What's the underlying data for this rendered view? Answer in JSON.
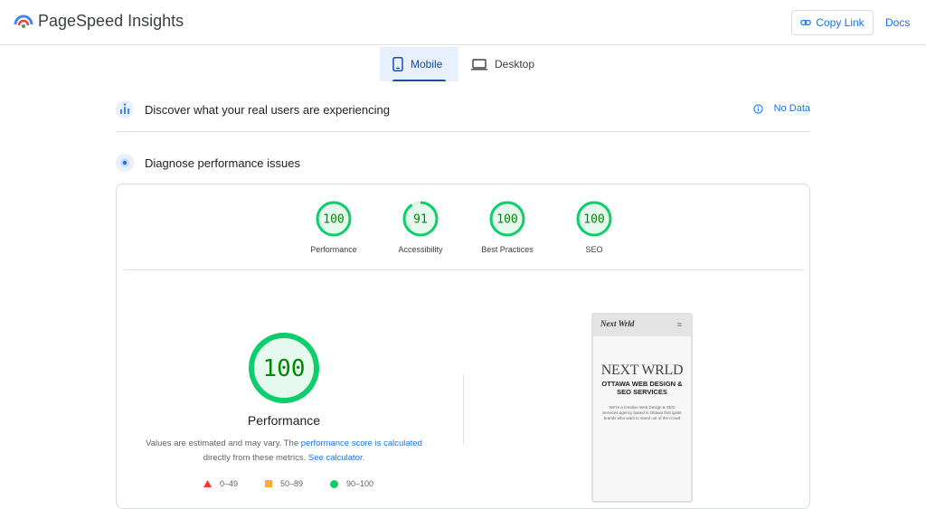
{
  "header": {
    "app_title": "PageSpeed Insights",
    "copy_link_label": "Copy Link",
    "docs_label": "Docs"
  },
  "tabs": [
    {
      "label": "Mobile",
      "active": true,
      "icon": "phone-icon"
    },
    {
      "label": "Desktop",
      "active": false,
      "icon": "laptop-icon"
    }
  ],
  "real_users": {
    "title": "Discover what your real users are experiencing",
    "status": "No Data",
    "icon": "crux-users-icon"
  },
  "diagnose": {
    "title": "Diagnose performance issues",
    "icon": "lighthouse-icon"
  },
  "scores": [
    {
      "label": "Performance",
      "value": "100",
      "fraction": 1.0
    },
    {
      "label": "Accessibility",
      "value": "91",
      "fraction": 0.91
    },
    {
      "label": "Best Practices",
      "value": "100",
      "fraction": 1.0
    },
    {
      "label": "SEO",
      "value": "100",
      "fraction": 1.0
    }
  ],
  "main_score": {
    "value": "100",
    "label": "Performance",
    "fraction": 1.0
  },
  "note": {
    "prefix": "Values are estimated and may vary. The ",
    "link1": "performance score is calculated",
    "middle": " directly from these metrics. ",
    "link2": "See calculator."
  },
  "legend": [
    {
      "range": "0–49",
      "color": "#ff3333",
      "shape": "triangle"
    },
    {
      "range": "50–89",
      "color": "#ffaa33",
      "shape": "square"
    },
    {
      "range": "90–100",
      "color": "#0cce6b",
      "shape": "circle"
    }
  ],
  "colors": {
    "pass_stroke": "#0cce6b",
    "pass_fill": "#e6f9ee",
    "pass_text": "#008800",
    "accent": "#1a73e8"
  },
  "screenshot": {
    "logo_text": "Next Wrld",
    "headline": "NEXT WRLD",
    "subheadline": "OTTAWA WEB DESIGN & SEO SERVICES",
    "paragraph": "We're a creative Web Design & SEO Services agency based in Ottawa that ignite brands who want to stand out of the crowd"
  }
}
